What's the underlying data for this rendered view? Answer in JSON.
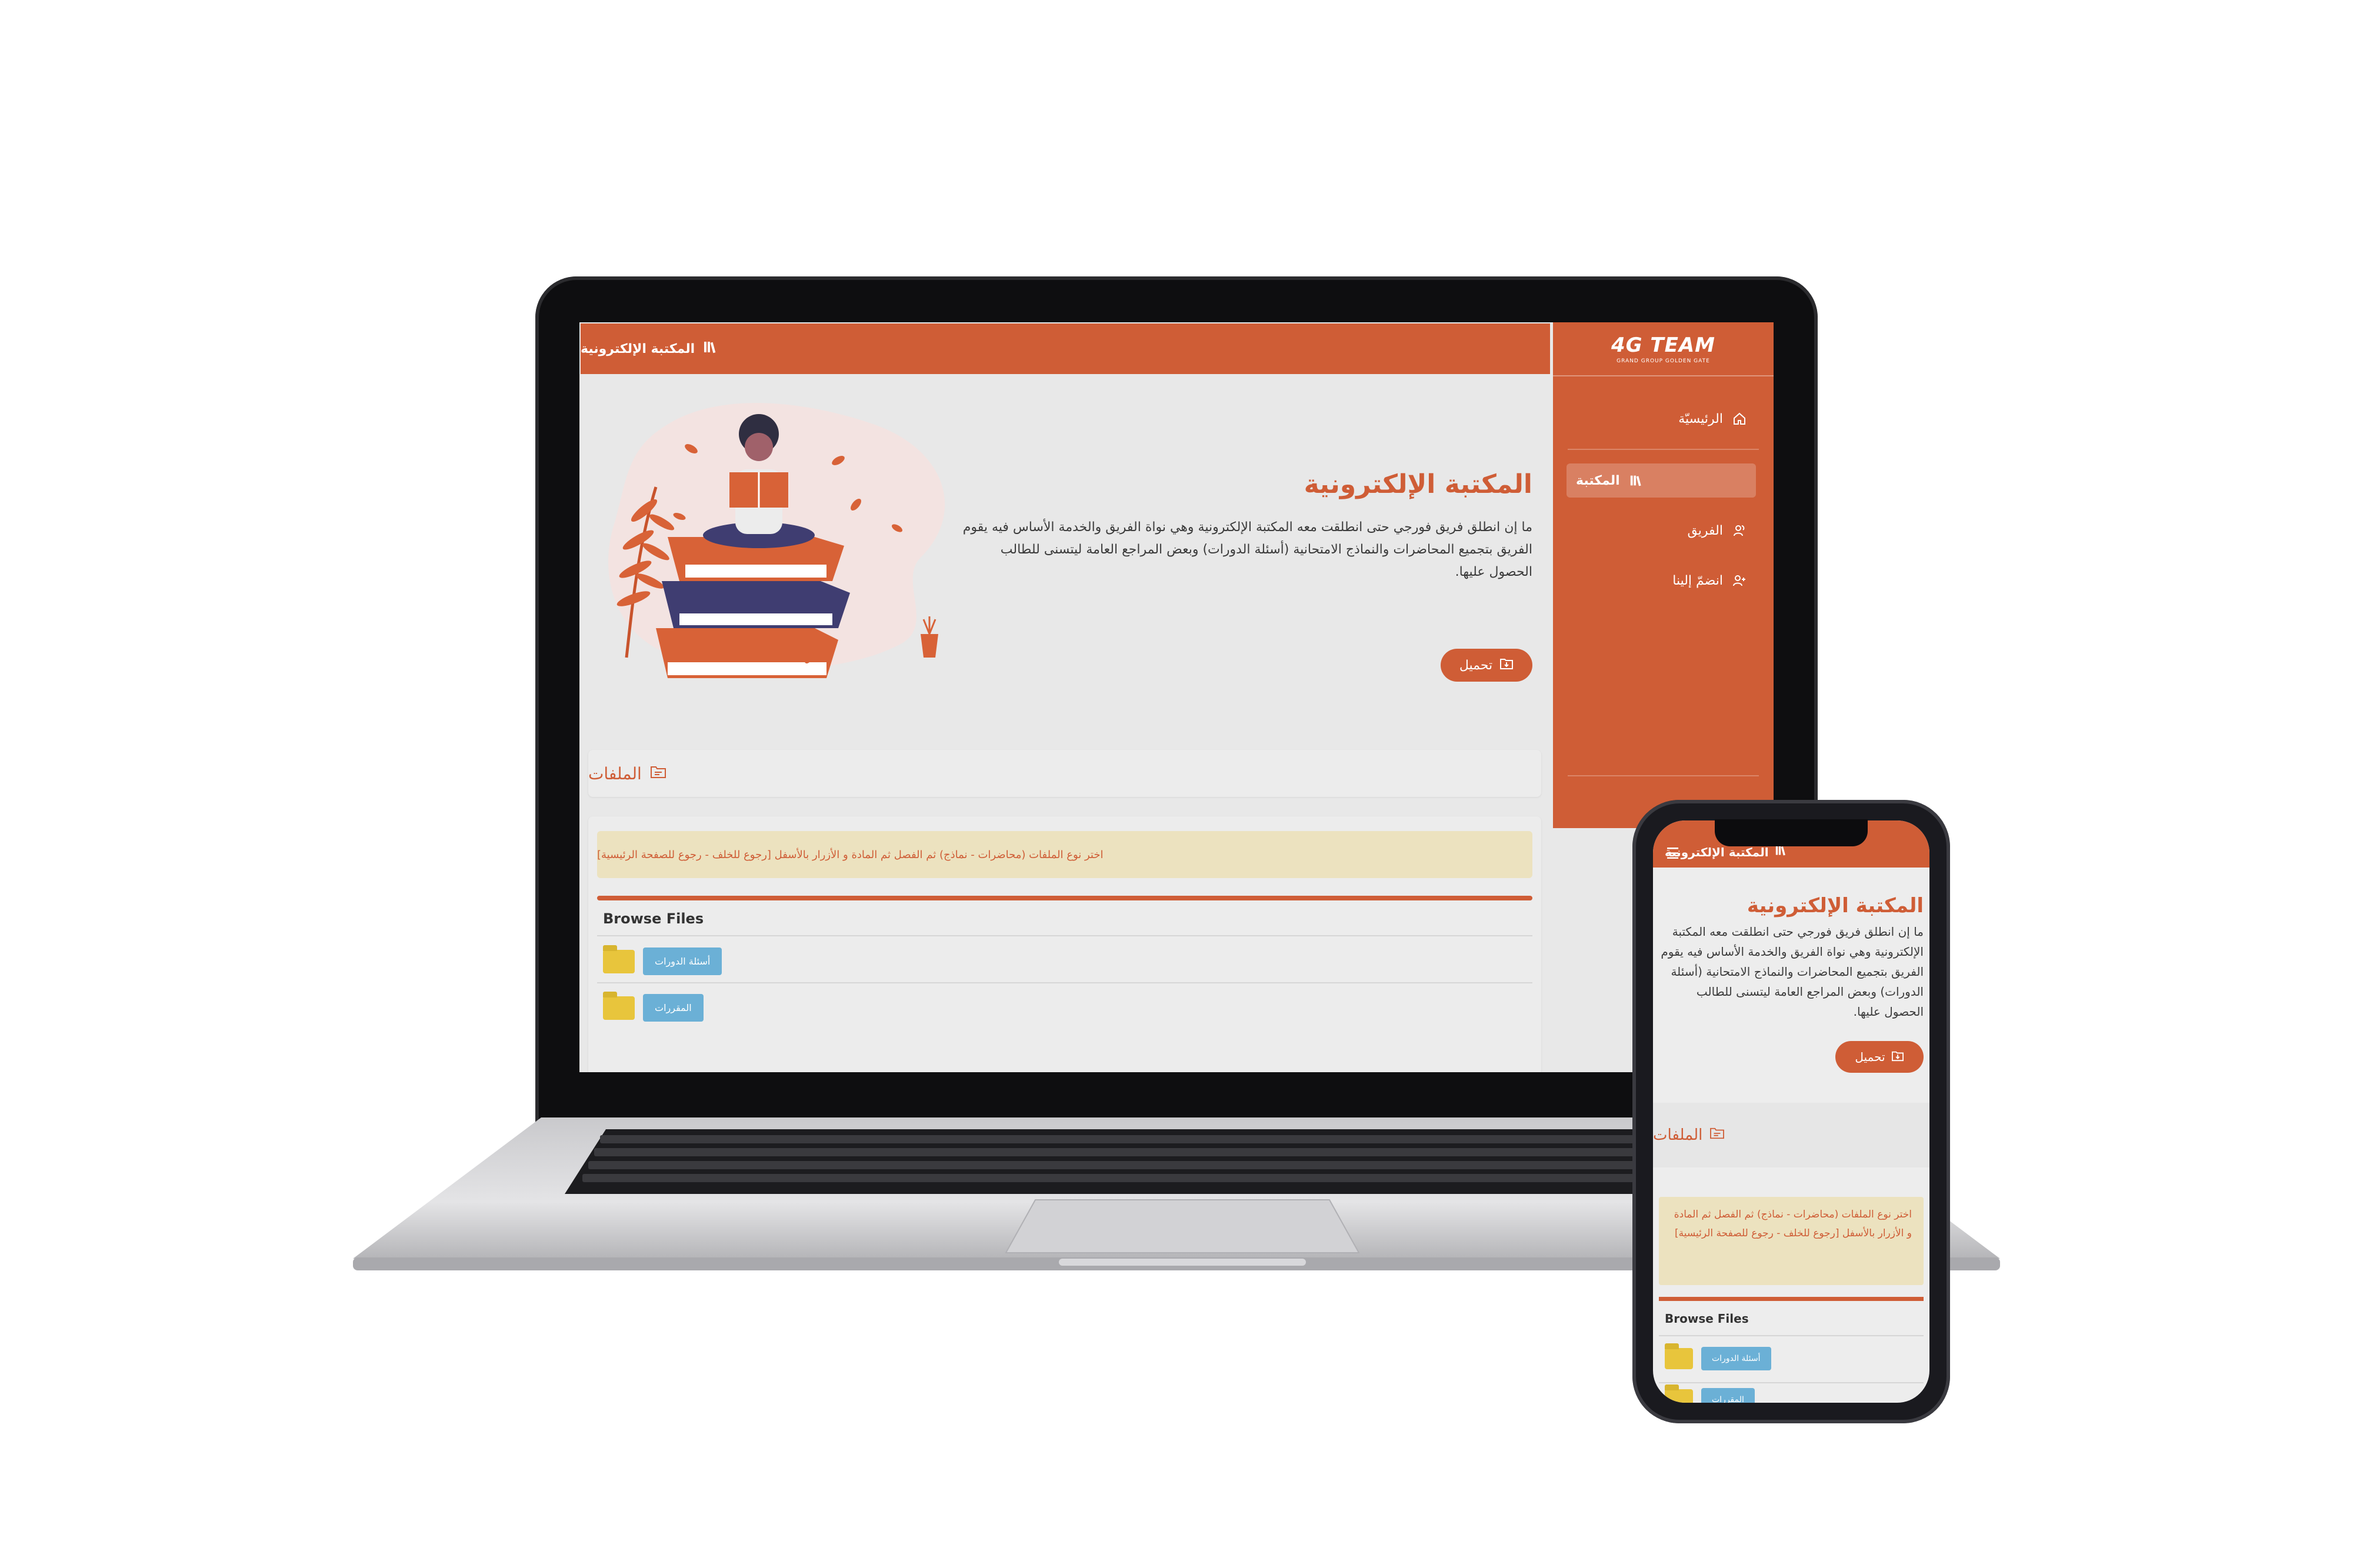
{
  "brand": {
    "logo_main": "4G TEAM",
    "logo_sub": "GRAND GROUP GOLDEN GATE"
  },
  "sidebar": {
    "items": [
      {
        "label": "الرئيسيّة",
        "icon": "home-icon"
      },
      {
        "label": "المكتبة",
        "icon": "library-icon",
        "active": true
      },
      {
        "label": "الفريق",
        "icon": "team-icon"
      },
      {
        "label": "انضمّ إلينا",
        "icon": "add-user-icon"
      }
    ]
  },
  "header": {
    "title": "المكتبة الإلكترونية",
    "icon": "library-icon"
  },
  "hero": {
    "title": "المكتبة الإلكترونية",
    "text": "ما إن انطلق فريق فورجي حتى انطلقت معه المكتبة الإلكترونية وهي نواة الفريق والخدمة الأساس فيه يقوم الفريق بتجميع المحاضرات والنماذج الامتحانية (أسئلة الدورات) وبعض المراجع العامة ليتسنى للطالب الحصول عليها.",
    "download_label": "تحميل"
  },
  "files": {
    "heading": "الملفات",
    "alert": "اختر نوع الملفات (محاضرات - نماذج) ثم الفصل ثم المادة و الأزرار بالأسفل [رجوع للخلف - رجوع للصفحة الرئيسية]",
    "browse_title": "Browse Files",
    "folders": [
      {
        "label": "أسئلة الدورات"
      },
      {
        "label": "المقررات"
      }
    ]
  },
  "colors": {
    "accent": "#cf5d36",
    "alert_bg": "#ece2bf",
    "tag": "#6bb0d6",
    "folder": "#e8c53c"
  }
}
